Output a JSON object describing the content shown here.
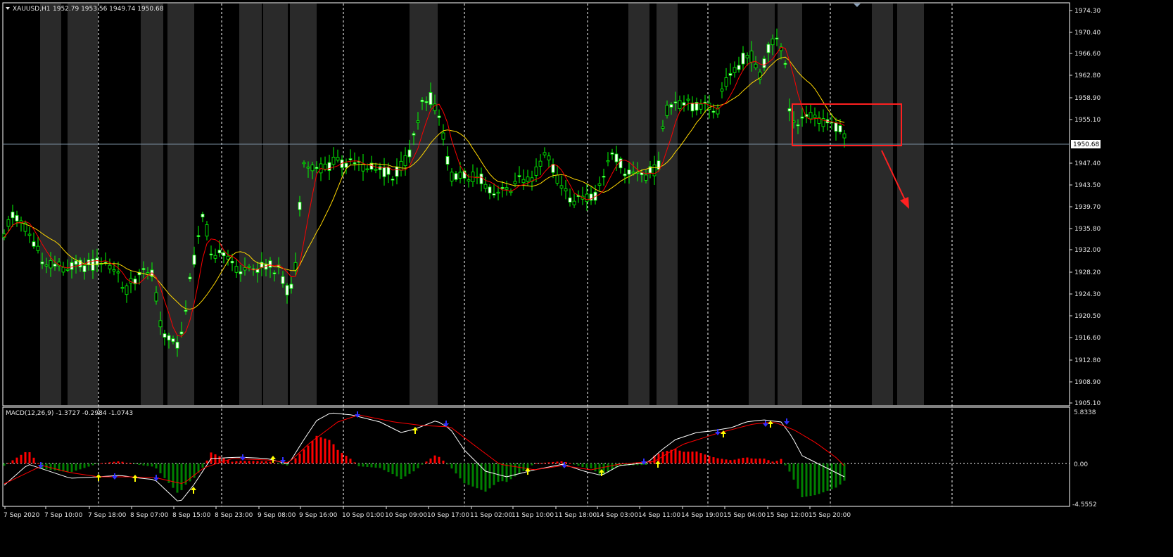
{
  "main_header": {
    "symbol": "XAUUSD,H1",
    "ohlc": "1952.79 1953.56 1949.74 1950.68"
  },
  "macd_header": {
    "text": "MACD(12,26,9) -1.3727 -0.2984 -1.0743"
  },
  "price_axis": {
    "ticks": [
      "1974.30",
      "1970.40",
      "1966.60",
      "1962.80",
      "1958.90",
      "1955.10",
      "1947.40",
      "1943.50",
      "1939.70",
      "1935.80",
      "1932.00",
      "1928.20",
      "1924.30",
      "1920.50",
      "1916.60",
      "1912.80",
      "1908.90",
      "1905.10"
    ],
    "current_price": "1950.68"
  },
  "macd_axis": {
    "ticks": [
      "5.8338",
      "0.00",
      "-4.5552"
    ]
  },
  "time_axis": {
    "ticks": [
      "7 Sep 2020",
      "7 Sep 10:00",
      "7 Sep 18:00",
      "8 Sep 07:00",
      "8 Sep 15:00",
      "8 Sep 23:00",
      "9 Sep 08:00",
      "9 Sep 16:00",
      "10 Sep 01:00",
      "10 Sep 09:00",
      "10 Sep 17:00",
      "11 Sep 02:00",
      "11 Sep 10:00",
      "11 Sep 18:00",
      "14 Sep 03:00",
      "14 Sep 11:00",
      "14 Sep 19:00",
      "15 Sep 04:00",
      "15 Sep 12:00",
      "15 Sep 20:00"
    ]
  },
  "colors": {
    "background": "#000000",
    "bull_candle": "#ffffff",
    "bear_candle": "#000000",
    "wick": "#00ff00",
    "ma_fast": "#ff0000",
    "ma_slow": "#ffd700",
    "macd_positive": "#ff0000",
    "macd_negative": "#008000",
    "macd_line": "#ffffff",
    "signal_line": "#ff0000",
    "session_band": "#2a2a2a",
    "annotation": "#ff2020",
    "grid": "#ffffff"
  }
}
